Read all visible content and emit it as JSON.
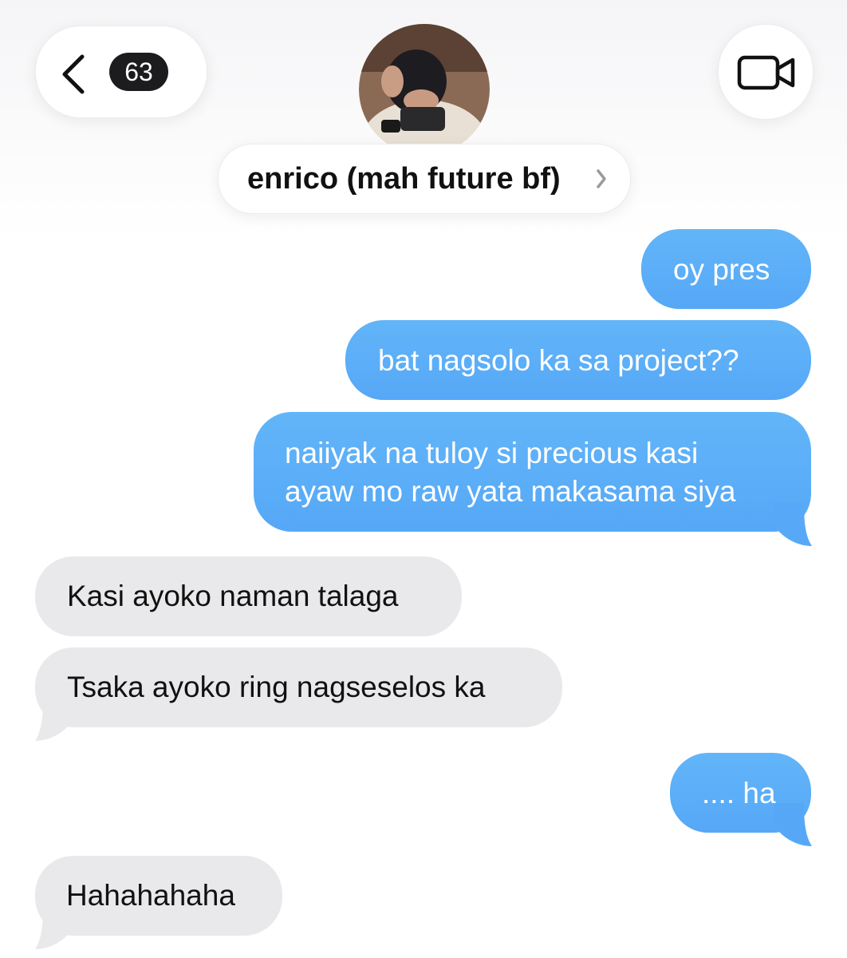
{
  "header": {
    "back_count": "63",
    "contact_name": "enrico (mah future bf)"
  },
  "icons": {
    "back": "chevron-left-icon",
    "video": "video-camera-icon",
    "name_disclosure": "chevron-right-icon"
  },
  "colors": {
    "sent_bubble": "#5aaef7",
    "received_bubble": "#e9e9eb",
    "badge": "#1c1c1e"
  },
  "messages": [
    {
      "direction": "sent",
      "text": "oy pres"
    },
    {
      "direction": "sent",
      "text": "bat nagsolo ka sa project??"
    },
    {
      "direction": "sent",
      "lines": [
        "naiiyak na tuloy si precious kasi",
        "ayaw mo raw yata makasama siya"
      ]
    },
    {
      "direction": "received",
      "text": "Kasi ayoko naman talaga"
    },
    {
      "direction": "received",
      "text": "Tsaka ayoko ring nagseselos ka"
    },
    {
      "direction": "sent",
      "text": ".... ha"
    },
    {
      "direction": "received",
      "text": "Hahahahaha"
    }
  ]
}
